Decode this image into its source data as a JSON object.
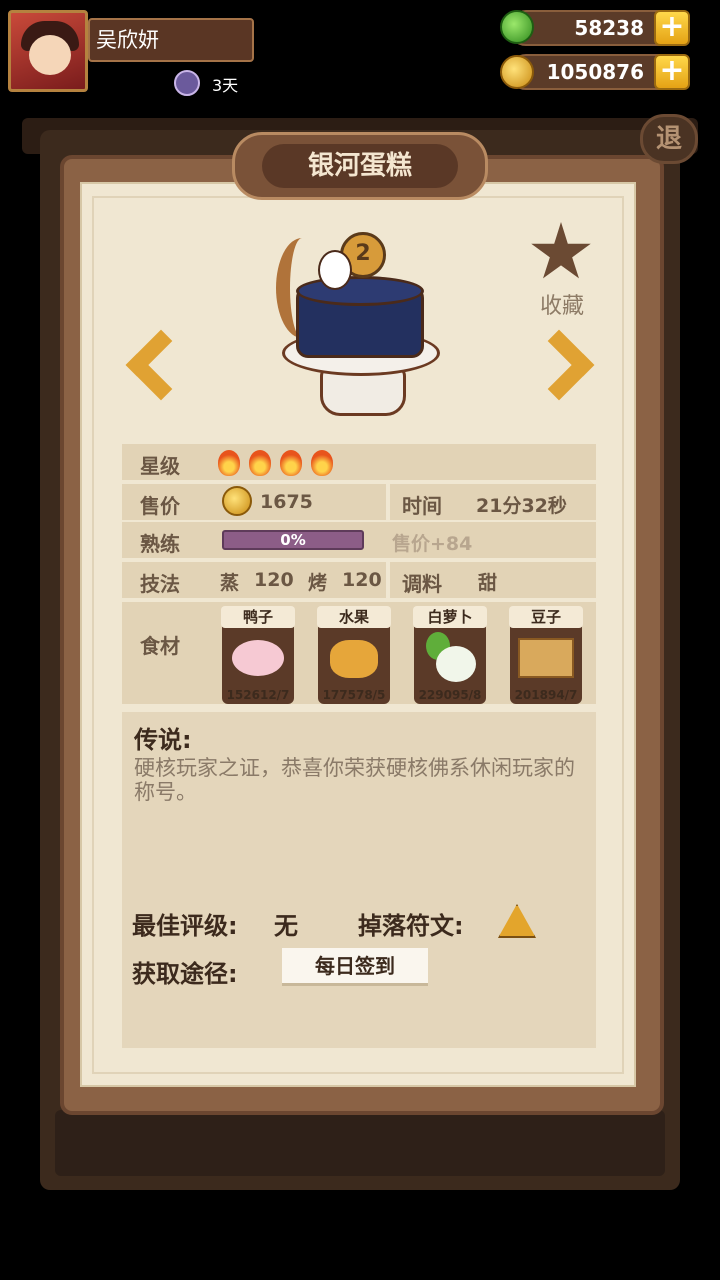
{
  "player": {
    "name": "吴欣妍",
    "days": "3天"
  },
  "currency": {
    "jade": "58238",
    "gold": "1050876",
    "plus": "+"
  },
  "back_label": "退",
  "item": {
    "title": "银河蛋糕",
    "topper_number": "2",
    "favorite_label": "收藏",
    "star_label": "星级",
    "stars": 4,
    "price_label": "售价",
    "price": "1675",
    "time_label": "时间",
    "time": "21分32秒",
    "skill_label": "熟练",
    "skill_progress_text": "0%",
    "skill_progress": 0,
    "skill_bonus": "售价+84",
    "technique_label": "技法",
    "technique_1": "蒸",
    "technique_1_value": "120",
    "technique_2": "烤",
    "technique_2_value": "120",
    "seasoning_label": "调料",
    "seasoning": "甜",
    "ingredients_label": "食材",
    "ingredients": [
      {
        "name": "鸭子",
        "count": "152612/7"
      },
      {
        "name": "水果",
        "count": "177578/5"
      },
      {
        "name": "白萝卜",
        "count": "229095/8"
      },
      {
        "name": "豆子",
        "count": "201894/7"
      }
    ],
    "legend_title": "传说:",
    "legend_text": "硬核玩家之证，恭喜你荣获硬核佛系休闲玩家的称号。",
    "best_rating_label": "最佳评级:",
    "best_rating": "无",
    "drop_rune_label": "掉落符文:",
    "source_label": "获取途径:",
    "source_button": "每日签到"
  }
}
